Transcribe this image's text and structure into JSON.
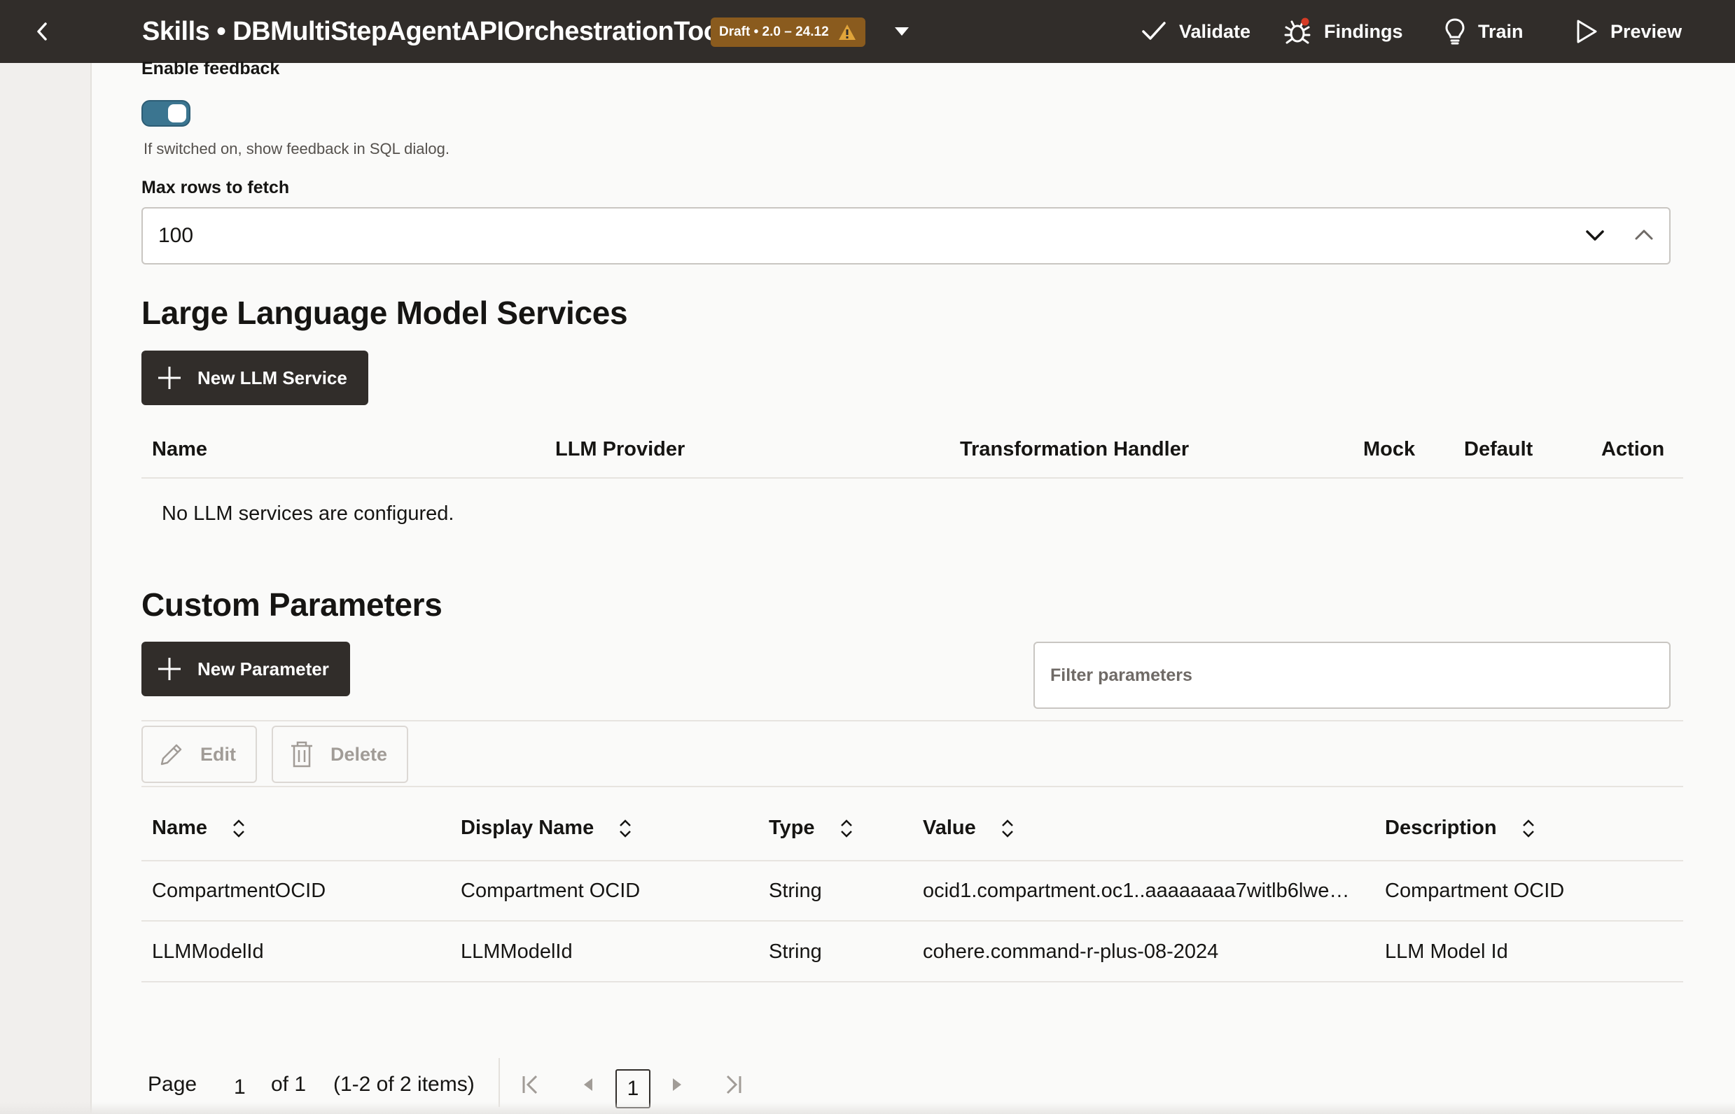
{
  "header": {
    "title": "Skills • DBMultiStepAgentAPIOrchestrationTool",
    "badge": "Draft • 2.0 – 24.12",
    "actions": [
      {
        "label": "Validate",
        "icon": "check-icon"
      },
      {
        "label": "Findings",
        "icon": "bug-icon"
      },
      {
        "label": "Train",
        "icon": "lightbulb-icon"
      },
      {
        "label": "Preview",
        "icon": "play-icon"
      }
    ]
  },
  "feedback": {
    "label": "Enable feedback",
    "enabled": true,
    "help": "If switched on, show feedback in SQL dialog."
  },
  "max_rows": {
    "label": "Max rows to fetch",
    "value": "100"
  },
  "llm_services": {
    "heading": "Large Language Model Services",
    "new_button": "New LLM Service",
    "columns": [
      "Name",
      "LLM Provider",
      "Transformation Handler",
      "Mock",
      "Default",
      "Action"
    ],
    "empty_message": "No LLM services are configured."
  },
  "custom_params": {
    "heading": "Custom Parameters",
    "new_button": "New Parameter",
    "filter_placeholder": "Filter parameters",
    "edit_button": "Edit",
    "delete_button": "Delete",
    "columns": [
      "Name",
      "Display Name",
      "Type",
      "Value",
      "Description"
    ],
    "rows": [
      [
        "CompartmentOCID",
        "Compartment OCID",
        "String",
        "ocid1.compartment.oc1..aaaaaaaa7witlb6lwe…",
        "Compartment OCID"
      ],
      [
        "LLMModelId",
        "LLMModelId",
        "String",
        "cohere.command-r-plus-08-2024",
        "LLM Model Id"
      ]
    ]
  },
  "pagination": {
    "page_label": "Page",
    "page_value": "1",
    "of_label": "of 1",
    "range": "(1-2 of 2 items)",
    "current": "1"
  },
  "colors": {
    "header_bg": "#312d2a",
    "badge_bg": "#8a5b1e",
    "warning": "#e0a43a",
    "toggle_on": "#3b7590",
    "findings_dot": "#d63b25"
  }
}
